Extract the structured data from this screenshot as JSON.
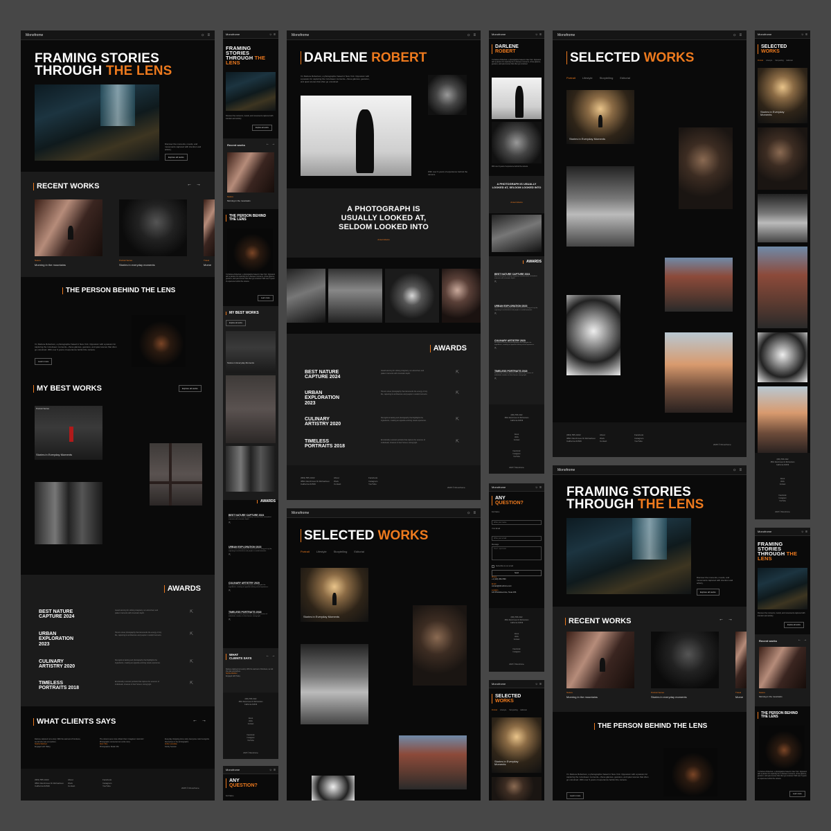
{
  "brand": "Monofrome",
  "colors": {
    "accent": "#ee7a1e",
    "bg": "#0a0a0a",
    "panel": "#1b1b1b",
    "canvas": "#474747"
  },
  "icons": {
    "theme": "sun-icon",
    "menu": "menu-icon",
    "arrow_prev": "arrow-left-icon",
    "arrow_next": "arrow-right-icon",
    "external": "external-link-icon"
  },
  "hero": {
    "line1": "FRAMING STORIES",
    "line2a": "THROUGH ",
    "line2b": "THE LENS",
    "mline1": "FRAMING",
    "mline2": "STORIES",
    "mline3a": "THROUGH ",
    "mline3b": "THE",
    "mline4": "LENS",
    "desc": "Discover the moments, moods, and movements captured with intention and artistry.",
    "cta": "Explore all works"
  },
  "recent": {
    "title": "RECENT WORKS",
    "title_small": "Recent works",
    "items": [
      {
        "tag": "Nature",
        "title": "Morning in the mountains"
      },
      {
        "tag": "Portrait Series",
        "title": "Stories in everyday moments"
      },
      {
        "tag": "Travel",
        "title": "Mome"
      }
    ]
  },
  "person": {
    "title": "THE PERSON BEHIND THE LENS",
    "title_m1": "THE PERSON BEHIND",
    "title_m2": "THE LENS",
    "bio": "I'm Darlene Robertson, a photographer based in New York. Opposium with a passion for capturing the in-between moments—those glances, gestures, and quiet scenes that often go unnoticed. With over 9 years of experience behind the camera.",
    "cta": "Learn more"
  },
  "best": {
    "title": "MY BEST WORKS",
    "cta": "Explore all works",
    "tag": "Portrait Series",
    "caption": "Stories in Everyday Moments"
  },
  "awards": {
    "title": "AWARDS",
    "items": [
      {
        "t1": "BEST NATURE",
        "t2": "CAPTURE 2024",
        "mono": "BEST NATURE CAPTURE 2024",
        "desc": "Award-winning for striking imaginary, sun-drenched, and patient moments with cinematic depth."
      },
      {
        "t1": "URBAN",
        "t2": "EXPLORATION",
        "t3": "2023",
        "mono": "URBAN EXPLORATION 2023",
        "desc": "Honors street photography that transcends the energy of city life, capturing its architecture and people in candid moments."
      },
      {
        "t1": "CULINARY",
        "t2": "ARTISTRY 2020",
        "mono": "CULINARY ARTISTRY 2020",
        "desc": "Recognized tasting and photography that highlights the ingredients, creating an appetite-enticing visual experience."
      },
      {
        "t1": "TIMELESS",
        "t2": "PORTRAITS 2018",
        "mono": "TIMELESS PORTRAITS 2018",
        "desc": "Emotionally resonant portraits that capture the essence of individuals, timeless in their honest, strong light."
      }
    ]
  },
  "clients": {
    "title": "WHAT CLIENTS SAYS",
    "m1": "WHAT",
    "m2": "CLIENTS SAYS",
    "quotes": [
      {
        "text": "Darlene captured not a story. With the warmest of fondness, we felt she was everywhere.",
        "name": "Sophie Martinez",
        "role": "Engaged with Hailey"
      },
      {
        "text": "The colours were more vibrant than I imagined. Jammick! Photographs connected our entire story.",
        "name": "Alam Vibe",
        "role": "Photographer Retain Mix"
      },
      {
        "text": "Everyday shopping into a story. Everyone could recognize themselves in her photographs.",
        "name": "Anthe Lancellas",
        "role": "Family Session"
      }
    ]
  },
  "footer": {
    "phone": "(684) 555-0102",
    "addr1": "3891 Ranchview Dr.Richardson",
    "addr2": "California 62639",
    "links": [
      "About",
      "Work",
      "Contact"
    ],
    "social": [
      "Facebook",
      "Instagram",
      "YouTube"
    ],
    "copy": "2025 © Monofrome"
  },
  "about": {
    "first": "DARLENE ",
    "last": "ROBERT",
    "intro": "I'm Darlene Robertson, a photographer based in New York. Opposium with a passion for capturing the in-between moments—those glances, gestures, and quiet scenes that often go unnoticed.",
    "experience": "With over 9 years of experience behind the camera.",
    "quote1": "A PHOTOGRAPH IS",
    "quote2": "USUALLY LOOKED AT,",
    "quote3": "SELDOM LOOKED INTO",
    "quote_author": "Ansel Adams",
    "mquote": "A PHOTOGRAPH IS USUALLY LOOKED AT, SELDOM LOOKED INTO",
    "mfirst": "DARLENE",
    "mlast": "ROBERT"
  },
  "selected": {
    "t1": "SELECTED ",
    "t2": "WORKS",
    "tabs": [
      "Portrait",
      "Lifestyle",
      "Storytelling",
      "Editorial"
    ],
    "caption": "Stories in Everyday Moments",
    "mcap1": "Stories in Everyday",
    "mcap2": "Moments"
  },
  "contact": {
    "t1": "ANY",
    "t2": "QUESTION?",
    "fields": [
      {
        "label": "Full Name",
        "placeholder": "Write your name"
      },
      {
        "label": "Your Email",
        "placeholder": "Write your email"
      },
      {
        "label": "Message",
        "placeholder": "Your opinion"
      }
    ],
    "subscribe": "Subscribe to our email",
    "send": "Send",
    "phone_label": "Phone",
    "phone": "+1 (123) 456-7890",
    "email_label": "Email",
    "email": "contact@Monofrome.com",
    "loc_label": "Location",
    "loc": "123 Photostreet Ave, Texas 456",
    "full_name_small": "Full Name"
  }
}
